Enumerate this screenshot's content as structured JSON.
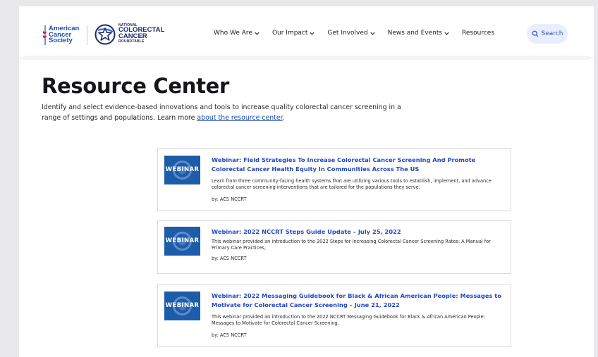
{
  "header": {
    "acs_logo_lines": [
      "American",
      "Cancer",
      "Society"
    ],
    "nccrt_lines": {
      "top": "NATIONAL",
      "mid": [
        "COLORECTAL",
        "CANCER"
      ],
      "bottom": "ROUNDTABLE"
    },
    "nav": [
      {
        "label": "Who We Are",
        "dropdown": true
      },
      {
        "label": "Our Impact",
        "dropdown": true
      },
      {
        "label": "Get Involved",
        "dropdown": true
      },
      {
        "label": "News and Events",
        "dropdown": true
      },
      {
        "label": "Resources",
        "dropdown": false
      }
    ],
    "search_label": "Search"
  },
  "hero": {
    "title": "Resource Center",
    "intro_text": "Identify and select evidence-based innovations and tools to increase quality colorectal cancer screening in a range of settings and populations. Learn more ",
    "intro_link": "about the resource center",
    "intro_end": "."
  },
  "resources": [
    {
      "thumb_label": "WEBINAR",
      "title": "Webinar: Field Strategies To Increase Colorectal Cancer Screening And Promote Colorectal Cancer Health Equity In Communities Across The US",
      "description": "Learn from three community-facing health systems that are utilizing various tools to establish, implement, and advance colorectal cancer screening interventions that are tailored for the populations they serve.",
      "byline": "by: ACS NCCRT"
    },
    {
      "thumb_label": "WEBINAR",
      "title": "Webinar: 2022 NCCRT Steps Guide Update – July 25, 2022",
      "description": "This webinar provided an introduction to the 2022 Steps for Increasing Colorectal Cancer Screening Rates: A Manual for Primary Care Practices,",
      "byline": "by: ACS NCCRT"
    },
    {
      "thumb_label": "WEBINAR",
      "title": "Webinar: 2022 Messaging Guidebook for Black & African American People: Messages to Motivate for Colorectal Cancer Screening – June 21, 2022",
      "description": "This webinar provided an introduction to the 2022 NCCRT Messaging Guidebook for Black & African American People: Messages to Motivate for Colorectal Cancer Screening.",
      "byline": "by: ACS NCCRT"
    }
  ],
  "colors": {
    "link_blue": "#2548c4",
    "thumb_blue": "#1d5ca8",
    "search_bg": "#e8eefb",
    "acs_red": "#d5202f"
  }
}
